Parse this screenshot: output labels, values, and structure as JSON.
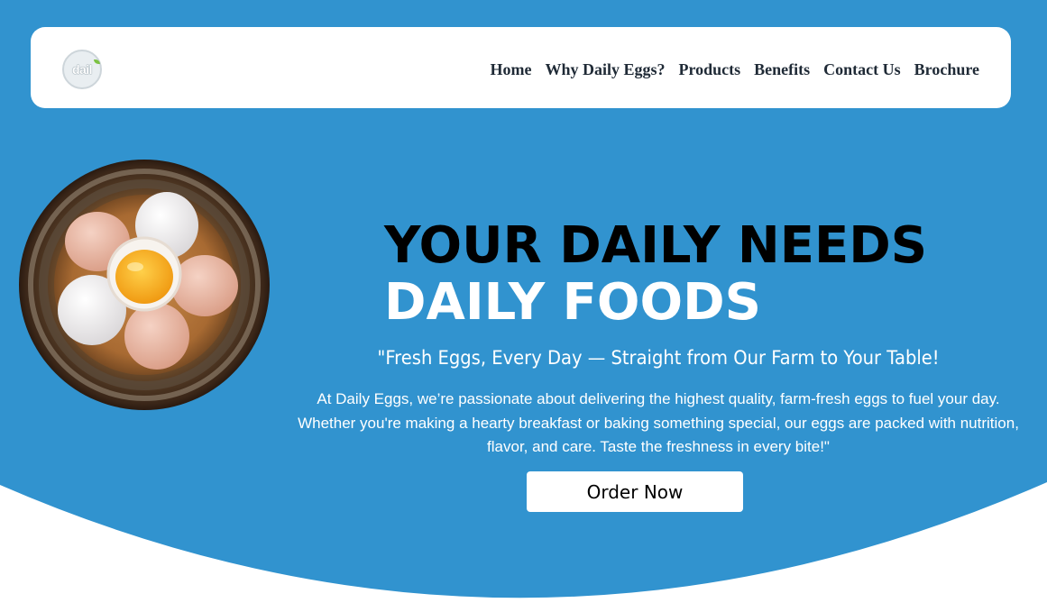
{
  "colors": {
    "hero_blue": "#3193cf",
    "white": "#ffffff",
    "nav_text": "#1f2a36",
    "headline_dark": "#000000"
  },
  "logo": {
    "text": "dail",
    "icon": "daily-eggs-logo"
  },
  "nav": {
    "items": [
      {
        "label": "Home"
      },
      {
        "label": "Why Daily Eggs?"
      },
      {
        "label": "Products"
      },
      {
        "label": "Benefits"
      },
      {
        "label": "Contact Us"
      },
      {
        "label": "Brochure"
      }
    ]
  },
  "hero": {
    "image": "egg-bowl-image",
    "headline_line1": "YOUR DAILY NEEDS",
    "headline_line2": "DAILY FOODS",
    "tagline": "\"Fresh Eggs, Every Day — Straight from Our Farm to Your Table!",
    "description": "At Daily Eggs, we’re passionate about delivering the highest quality, farm-fresh eggs to fuel your day. Whether you're making a hearty breakfast or baking something special, our eggs are packed with nutrition, flavor, and care. Taste the freshness in every bite!\"",
    "cta_label": "Order Now"
  }
}
